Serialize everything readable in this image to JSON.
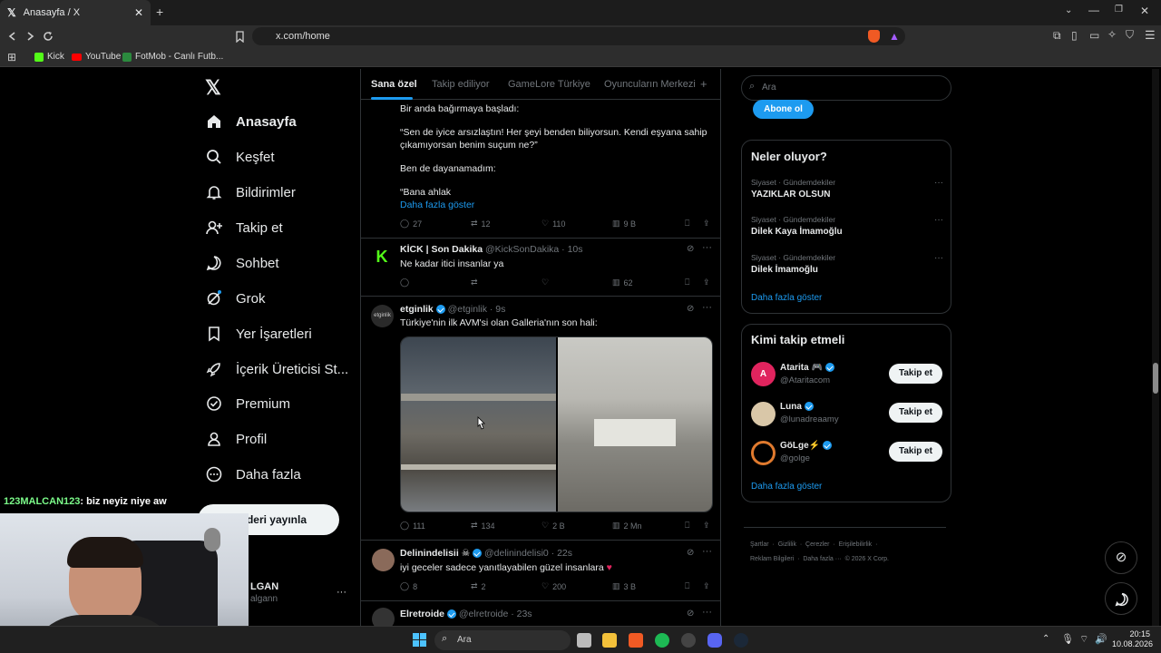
{
  "browser": {
    "tab_title": "Anasayfa / X",
    "url": "x.com/home",
    "bookmarks": [
      "Kick",
      "YouTube",
      "FotMob - Canlı Futb..."
    ]
  },
  "nav": {
    "items": [
      "Anasayfa",
      "Keşfet",
      "Bildirimler",
      "Takip et",
      "Sohbet",
      "Grok",
      "Yer İşaretleri",
      "İçerik Üreticisi St...",
      "Premium",
      "Profil",
      "Daha fazla"
    ],
    "post_button": "deri yayınla",
    "account_name": "LGAN",
    "account_handle": "algann"
  },
  "overlay": {
    "chat_user": "123MALCAN123",
    "chat_message": ": biz neyiz niye aw"
  },
  "feed": {
    "tabs": [
      "Sana özel",
      "Takip ediliyor",
      "GameLore Türkiye",
      "Oyuncuların Merkezi"
    ],
    "active_tab": "Sana özel",
    "tweet0": {
      "lines": [
        "Bir anda bağırmaya başladı:",
        "“Sen de iyice arsızlaştın! Her şeyi benden biliyorsun. Kendi eşyana sahip",
        "çıkamıyorsan benim suçum ne?”",
        "Ben de dayanamadım:",
        "“Bana ahlak"
      ],
      "show_more": "Daha fazla göster",
      "replies": "27",
      "reposts": "12",
      "likes": "110",
      "views": "9 B"
    },
    "tweet1": {
      "name": "KİCK | Son Dakika",
      "handle": "@KickSonDakika",
      "time": "· 10s",
      "text": "Ne kadar itici insanlar ya",
      "views": "62"
    },
    "tweet2": {
      "name": "etginlik",
      "handle": "@etginlik",
      "time": "· 9s",
      "text": "Türkiye'nin ilk AVM'si olan Galleria'nın son hali:",
      "replies": "111",
      "reposts": "134",
      "likes": "2 B",
      "views": "2 Mn"
    },
    "tweet3": {
      "name": "Delinindelisii",
      "handle": "@delinindelisi0",
      "time": "· 22s",
      "text": "iyi geceler sadece yanıtlayabilen güzel insanlara",
      "replies": "8",
      "reposts": "2",
      "likes": "200",
      "views": "3 B"
    },
    "tweet4": {
      "name": "Elretroide",
      "handle": "@elretroide",
      "time": "· 23s"
    }
  },
  "right": {
    "search_placeholder": "Ara",
    "subscribe": "Abone ol",
    "trends_title": "Neler oluyor?",
    "trends": [
      {
        "meta": "Siyaset · Gündemdekiler",
        "title": "YAZIKLAR OLSUN"
      },
      {
        "meta": "Siyaset · Gündemdekiler",
        "title": "Dilek Kaya İmamoğlu"
      },
      {
        "meta": "Siyaset · Gündemdekiler",
        "title": "Dilek İmamoğlu"
      }
    ],
    "trends_more": "Daha fazla göster",
    "follow_title": "Kimi takip etmeli",
    "follow": [
      {
        "name": "Atarita 🎮",
        "handle": "@Ataritacom",
        "btn": "Takip et"
      },
      {
        "name": "Luna",
        "handle": "@lunadreaamy",
        "btn": "Takip et"
      },
      {
        "name": "GöLge⚡",
        "handle": "@golge",
        "btn": "Takip et"
      }
    ],
    "follow_more": "Daha fazla göster",
    "footer1": "Şartlar  ·  Gizlilik  ·  Çerezler  ·  Erişilebilirlik  ·",
    "footer2": "Reklam Bilgileri  ·  Daha fazla ···  © 2026 X Corp."
  },
  "taskbar": {
    "search": "Ara",
    "time": "20:15",
    "date": "10.08.2026"
  }
}
